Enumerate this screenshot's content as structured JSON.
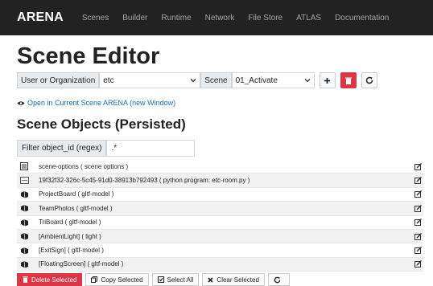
{
  "nav": {
    "brand": "ARENA",
    "links": [
      "Scenes",
      "Builder",
      "Runtime",
      "Network",
      "File Store",
      "ATLAS",
      "Documentation"
    ]
  },
  "page": {
    "title": "Scene Editor"
  },
  "controls": {
    "user_label": "User or Organization",
    "user_value": "etc",
    "scene_label": "Scene",
    "scene_value": "01_Activate"
  },
  "open_link": "Open in Current Scene ARENA (new Window)",
  "objects": {
    "heading": "Scene Objects (Persisted)",
    "filter_label": "Filter object_id (regex)",
    "filter_value": ".*",
    "rows": [
      {
        "text": "scene-options ( scene options )",
        "icon": "list-icon"
      },
      {
        "text": "19f32f32-326c-5c45-91d0-38913b792493 ( python program: etc-room.py )",
        "icon": "program-icon"
      },
      {
        "text": "ProjectBoard ( gltf-model )",
        "icon": "model-icon"
      },
      {
        "text": "TeamPhotos ( gltf-model )",
        "icon": "model-icon"
      },
      {
        "text": "TriBoard ( gltf-model )",
        "icon": "model-icon"
      },
      {
        "text": "[AmbientLight] ( light )",
        "icon": "model-icon"
      },
      {
        "text": "[ExitSign] ( gltf-model )",
        "icon": "model-icon"
      },
      {
        "text": "[FloatingScreen] ( gltf-model )",
        "icon": "model-icon"
      }
    ]
  },
  "buttons": {
    "delete_selected": "Delete Selected",
    "copy_selected": "Copy Selected",
    "select_all": "Select All",
    "clear_selected": "Clear Selected"
  },
  "colors": {
    "navbar": "#222222",
    "danger": "#dc3545",
    "link": "#1a6fb0"
  }
}
